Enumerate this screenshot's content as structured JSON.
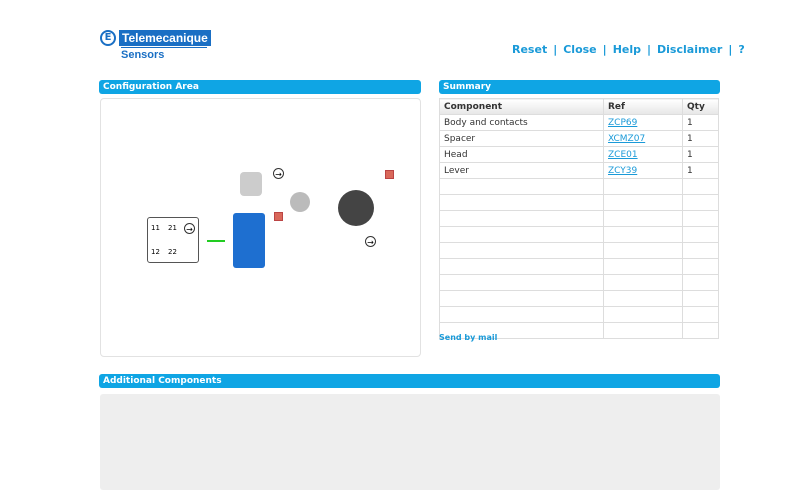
{
  "header": {
    "brand": "Telemecanique",
    "sub": "Sensors",
    "nav": [
      "Reset",
      "Close",
      "Help",
      "Disclaimer",
      "?"
    ]
  },
  "config": {
    "title": "Configuration Area",
    "diagram_labels": [
      "11",
      "21",
      "12",
      "22"
    ]
  },
  "summary": {
    "title": "Summary",
    "columns": [
      "Component",
      "Ref",
      "Qty"
    ],
    "rows": [
      {
        "component": "Body and contacts",
        "ref": "ZCP69",
        "qty": "1"
      },
      {
        "component": "Spacer",
        "ref": "XCMZ07",
        "qty": "1"
      },
      {
        "component": "Head",
        "ref": "ZCE01",
        "qty": "1"
      },
      {
        "component": "Lever",
        "ref": "ZCY39",
        "qty": "1"
      }
    ],
    "send": "Send by mail"
  },
  "additional": {
    "title": "Additional Components"
  }
}
